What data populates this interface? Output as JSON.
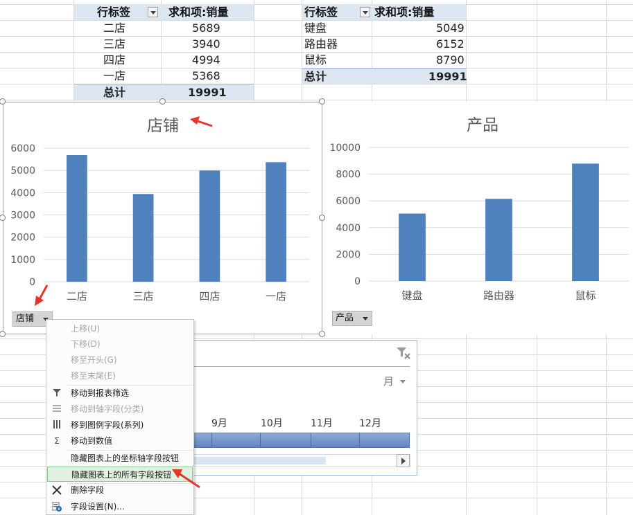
{
  "pivot1": {
    "header_label": "行标签",
    "header_value": "求和项:销量",
    "rows": [
      {
        "label": "二店",
        "value": "5689"
      },
      {
        "label": "三店",
        "value": "3940"
      },
      {
        "label": "四店",
        "value": "4994"
      },
      {
        "label": "一店",
        "value": "5368"
      }
    ],
    "total_label": "总计",
    "total_value": "19991"
  },
  "pivot2": {
    "header_label": "行标签",
    "header_value": "求和项:销量",
    "rows": [
      {
        "label": "键盘",
        "value": "5049"
      },
      {
        "label": "路由器",
        "value": "6152"
      },
      {
        "label": "鼠标",
        "value": "8790"
      }
    ],
    "total_label": "总计",
    "total_value": "19991"
  },
  "chart_data": [
    {
      "type": "bar",
      "title": "店铺",
      "categories": [
        "二店",
        "三店",
        "四店",
        "一店"
      ],
      "values": [
        5689,
        3940,
        4994,
        5368
      ],
      "yticks": [
        "0",
        "1000",
        "2000",
        "3000",
        "4000",
        "5000",
        "6000"
      ],
      "ylim": [
        0,
        6000
      ],
      "grid": true,
      "color": "#4f81bd",
      "field_button": "店铺"
    },
    {
      "type": "bar",
      "title": "产品",
      "categories": [
        "键盘",
        "路由器",
        "鼠标"
      ],
      "values": [
        5049,
        6152,
        8790
      ],
      "yticks": [
        "0",
        "2000",
        "4000",
        "6000",
        "8000",
        "10000"
      ],
      "ylim": [
        0,
        10000
      ],
      "grid": true,
      "color": "#4f81bd",
      "field_button": "产品"
    }
  ],
  "timeline": {
    "level": "月",
    "months": [
      "9月",
      "10月",
      "11月",
      "12月"
    ],
    "bar_color": "#6b8fc4"
  },
  "context_menu": {
    "items": [
      {
        "label": "上移(U)",
        "disabled": true,
        "icon": ""
      },
      {
        "label": "下移(D)",
        "disabled": true,
        "icon": ""
      },
      {
        "label": "移至开头(G)",
        "disabled": true,
        "icon": ""
      },
      {
        "label": "移至末尾(E)",
        "disabled": true,
        "icon": ""
      },
      {
        "label": "移动到报表筛选",
        "disabled": false,
        "icon": "filter-icon"
      },
      {
        "label": "移动到轴字段(分类)",
        "disabled": true,
        "icon": "rows-icon"
      },
      {
        "label": "移到图例字段(系列)",
        "disabled": false,
        "icon": "columns-icon"
      },
      {
        "label": "移动到数值",
        "disabled": false,
        "icon": "sigma-icon"
      },
      {
        "label": "隐藏图表上的坐标轴字段按钮",
        "disabled": false,
        "icon": ""
      },
      {
        "label": "隐藏图表上的所有字段按钮",
        "disabled": false,
        "icon": "",
        "highlighted": true
      },
      {
        "label": "删除字段",
        "disabled": false,
        "icon": "delete-icon"
      },
      {
        "label": "字段设置(N)...",
        "disabled": false,
        "icon": "field-settings-icon"
      }
    ]
  },
  "colors": {
    "accent": "#4f81bd",
    "pivot_header": "#dce6f1",
    "arrow": "#e8352b"
  }
}
